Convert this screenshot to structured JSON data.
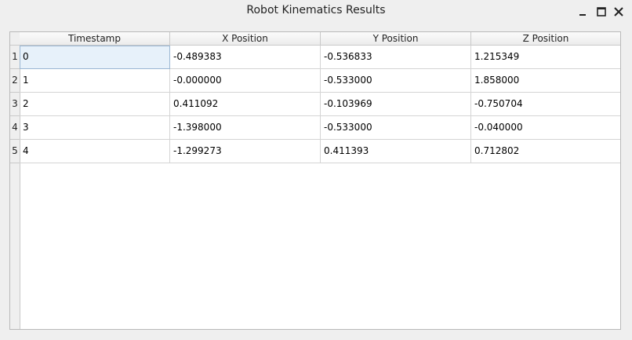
{
  "window": {
    "title": "Robot Kinematics Results"
  },
  "controls": {
    "minimize_icon": "minimize-icon",
    "maximize_icon": "maximize-icon",
    "close_icon": "close-icon"
  },
  "table": {
    "columns": [
      "Timestamp",
      "X Position",
      "Y Position",
      "Z Position"
    ],
    "row_labels": [
      "1",
      "2",
      "3",
      "4",
      "5"
    ],
    "rows": [
      [
        "0",
        "-0.489383",
        "-0.536833",
        "1.215349"
      ],
      [
        "1",
        "-0.000000",
        "-0.533000",
        "1.858000"
      ],
      [
        "2",
        "0.411092",
        "-0.103969",
        "-0.750704"
      ],
      [
        "3",
        "-1.398000",
        "-0.533000",
        "-0.040000"
      ],
      [
        "4",
        "-1.299273",
        "0.411393",
        "0.712802"
      ]
    ],
    "selected_cell": [
      0,
      0
    ]
  },
  "colors": {
    "selection": "#e7f1fa",
    "grid": "#d4d4d4"
  }
}
